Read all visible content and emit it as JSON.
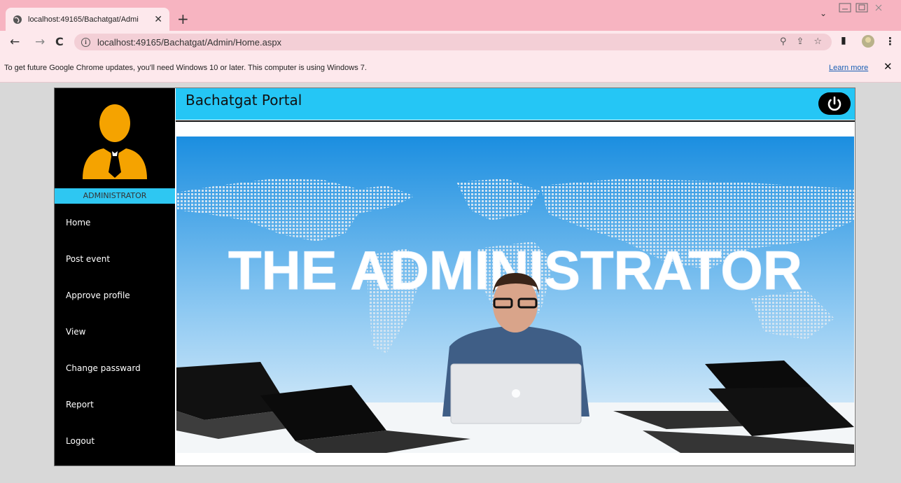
{
  "browser": {
    "tab_title": "localhost:49165/Bachatgat/Admi",
    "url": "localhost:49165/Bachatgat/Admin/Home.aspx",
    "infobar_message": "To get future Google Chrome updates, you'll need Windows 10 or later. This computer is using Windows 7.",
    "infobar_link": "Learn more"
  },
  "app": {
    "title": "Bachatgat Portal",
    "role": "ADMINISTRATOR",
    "banner_text": "THE ADMINISTRATOR"
  },
  "menu": [
    {
      "label": "Home"
    },
    {
      "label": "Post event"
    },
    {
      "label": "Approve profile"
    },
    {
      "label": "View"
    },
    {
      "label": "Change passward"
    },
    {
      "label": "Report"
    },
    {
      "label": "Logout"
    }
  ],
  "colors": {
    "header": "#25c6f5",
    "sidebar": "#000000",
    "avatar": "#f5a300",
    "tab_strip": "#f7b4c1"
  }
}
